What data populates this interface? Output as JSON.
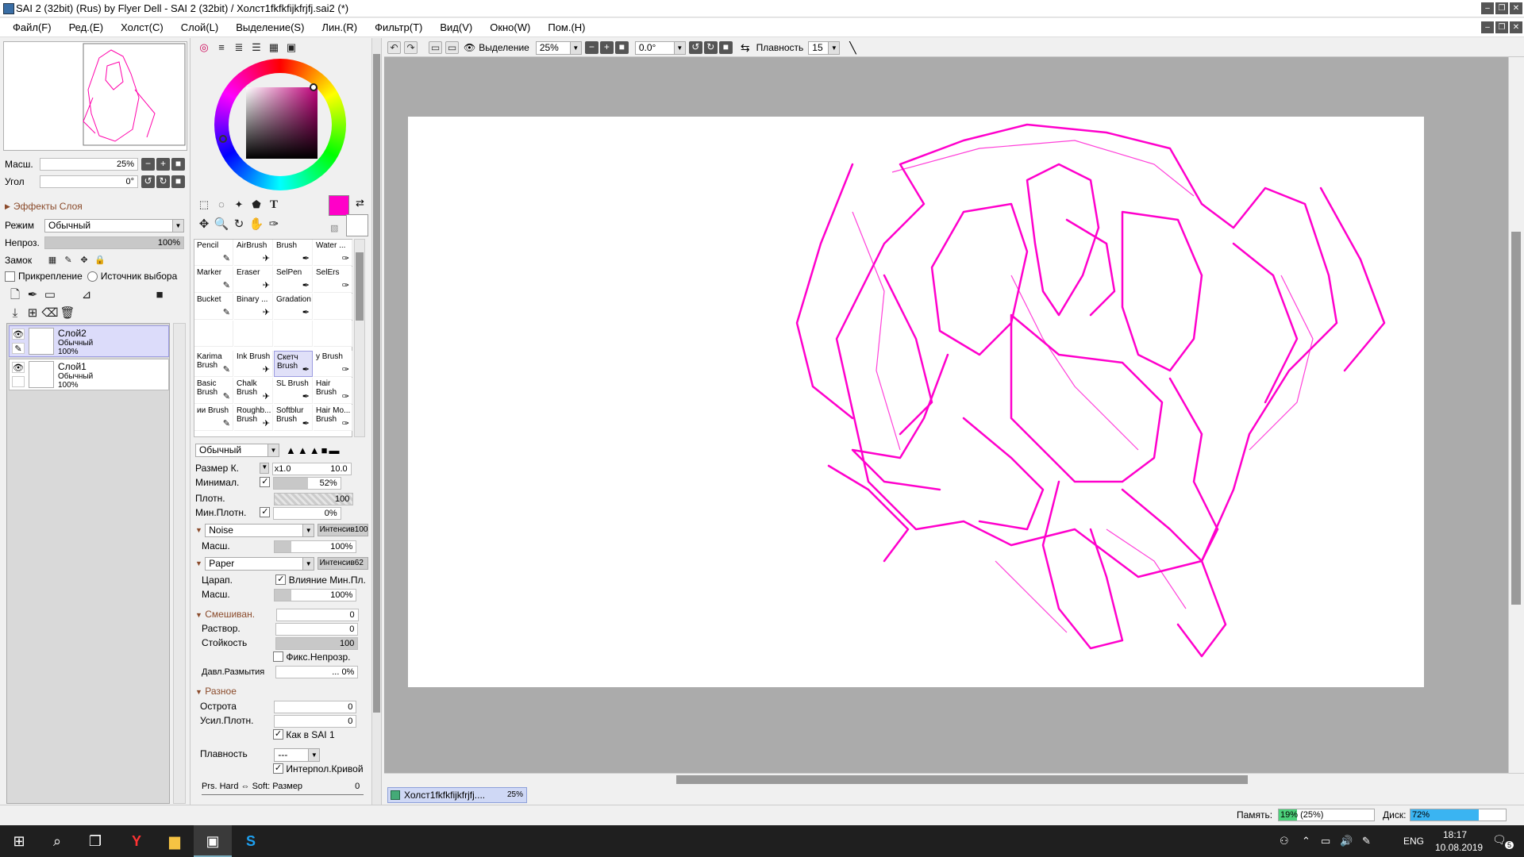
{
  "window": {
    "title": "SAI 2 (32bit) (Rus) by Flyer Dell - SAI 2 (32bit) / Холст1fkfkfijkfrjfj.sai2 (*)"
  },
  "menu": [
    "Файл(F)",
    "Ред.(E)",
    "Холст(C)",
    "Слой(L)",
    "Выделение(S)",
    "Лин.(R)",
    "Фильтр(T)",
    "Вид(V)",
    "Окно(W)",
    "Пом.(H)"
  ],
  "navigator": {
    "zoom_label": "Масш.",
    "zoom_value": "25%",
    "angle_label": "Угол",
    "angle_value": "0°"
  },
  "layer_panel": {
    "effects": "Эффекты Слоя",
    "mode_label": "Режим",
    "mode_value": "Обычный",
    "opacity_label": "Непроз.",
    "opacity_value": "100%",
    "lock_label": "Замок",
    "clip_label": "Прикрепление",
    "source_label": "Источник выбора",
    "layers": [
      {
        "name": "Слой2",
        "mode": "Обычный",
        "opacity": "100%",
        "selected": true
      },
      {
        "name": "Слой1",
        "mode": "Обычный",
        "opacity": "100%",
        "selected": false
      }
    ]
  },
  "colors": {
    "primary": "#ff00c8",
    "secondary": "#ffffff"
  },
  "brushes": [
    [
      "Pencil",
      "AirBrush",
      "Brush",
      "Water ..."
    ],
    [
      "Marker",
      "Eraser",
      "SelPen",
      "SelErs"
    ],
    [
      "Bucket",
      "Binary ...",
      "Gradation",
      ""
    ],
    [
      "",
      "",
      "",
      ""
    ],
    [
      "Karima Brush",
      "Ink Brush",
      "Скетч Brush",
      "у Brush"
    ],
    [
      "Basic Brush",
      "Chalk Brush",
      "SL Brush",
      "Hair Brush"
    ],
    [
      "ии Brush",
      "Roughb... Brush",
      "Softblur Brush",
      "Hair Mo... Brush"
    ]
  ],
  "brush_props": {
    "mode": "Обычный",
    "size_label": "Размер К.",
    "size_mult": "x1.0",
    "size_value": "10.0",
    "min_label": "Минимал.",
    "min_value": "52%",
    "density_label": "Плотн.",
    "density_value": "100",
    "min_density_label": "Мин.Плотн.",
    "min_density_value": "0%",
    "noise": "Noise",
    "intensity_label": "Интенсив",
    "noise_intensity": "100",
    "noise_scale_label": "Масш.",
    "noise_scale": "100%",
    "paper": "Paper",
    "paper_intensity": "62",
    "scratch_label": "Царап.",
    "influence_label": "Влияние Мин.Пл.",
    "paper_scale_label": "Масш.",
    "paper_scale": "100%",
    "blend_label": "Смешиван.",
    "blend_value": "0",
    "dilute_label": "Раствор.",
    "dilute_value": "0",
    "persist_label": "Стойкость",
    "persist_value": "100",
    "keep_opacity_label": "Фикс.Непрозр.",
    "blur_label": "Давл.Размытия",
    "blur_value": "... 0%",
    "misc_label": "Разное",
    "sharp_label": "Острота",
    "sharp_value": "0",
    "boost_label": "Усил.Плотн.",
    "boost_value": "0",
    "sai1_label": "Как в SAI 1",
    "smooth_label": "Плавность",
    "smooth_value": "---",
    "interp_label": "Интерпол.Кривой",
    "prs_label": "Prs. Hard ⇔ Soft: Размер",
    "prs_value": "0"
  },
  "toolbar": {
    "selection_label": "Выделение",
    "zoom_value": "25%",
    "angle_value": "0.0°",
    "smooth_label": "Плавность",
    "smooth_value": "15"
  },
  "doc_tab": {
    "name": "Холст1fkfkfijkfrjfj....",
    "zoom": "25%"
  },
  "status": {
    "memory_label": "Память:",
    "memory_value": "19% (25%)",
    "disk_label": "Диск:",
    "disk_value": "72%"
  },
  "taskbar": {
    "lang": "ENG",
    "time": "18:17",
    "date": "10.08.2019",
    "notif_count": "5"
  }
}
